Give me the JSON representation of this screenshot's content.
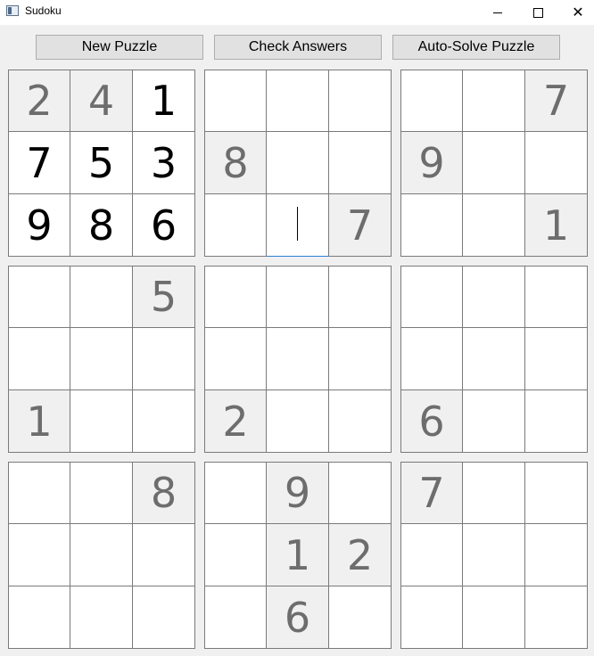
{
  "window": {
    "title": "Sudoku",
    "close_glyph": "✕"
  },
  "toolbar": {
    "new_puzzle": "New Puzzle",
    "check_answers": "Check Answers",
    "auto_solve": "Auto-Solve Puzzle"
  },
  "grid": [
    [
      [
        {
          "v": "2",
          "given": true
        },
        {
          "v": "4",
          "given": true
        },
        {
          "v": "1",
          "given": false
        }
      ],
      [
        {
          "v": "7",
          "given": false
        },
        {
          "v": "5",
          "given": false
        },
        {
          "v": "3",
          "given": false
        }
      ],
      [
        {
          "v": "9",
          "given": false
        },
        {
          "v": "8",
          "given": false
        },
        {
          "v": "6",
          "given": false
        }
      ]
    ],
    [
      [
        {
          "v": "",
          "given": false
        },
        {
          "v": "",
          "given": false
        },
        {
          "v": "",
          "given": false
        }
      ],
      [
        {
          "v": "8",
          "given": true
        },
        {
          "v": "",
          "given": false
        },
        {
          "v": "",
          "given": false
        }
      ],
      [
        {
          "v": "",
          "given": false
        },
        {
          "v": "",
          "given": false,
          "focused": true
        },
        {
          "v": "7",
          "given": true
        }
      ]
    ],
    [
      [
        {
          "v": "",
          "given": false
        },
        {
          "v": "",
          "given": false
        },
        {
          "v": "7",
          "given": true
        }
      ],
      [
        {
          "v": "9",
          "given": true
        },
        {
          "v": "",
          "given": false
        },
        {
          "v": "",
          "given": false
        }
      ],
      [
        {
          "v": "",
          "given": false
        },
        {
          "v": "",
          "given": false
        },
        {
          "v": "1",
          "given": true
        }
      ]
    ],
    [
      [
        {
          "v": "",
          "given": false
        },
        {
          "v": "",
          "given": false
        },
        {
          "v": "5",
          "given": true
        }
      ],
      [
        {
          "v": "",
          "given": false
        },
        {
          "v": "",
          "given": false
        },
        {
          "v": "",
          "given": false
        }
      ],
      [
        {
          "v": "1",
          "given": true
        },
        {
          "v": "",
          "given": false
        },
        {
          "v": "",
          "given": false
        }
      ]
    ],
    [
      [
        {
          "v": "",
          "given": false
        },
        {
          "v": "",
          "given": false
        },
        {
          "v": "",
          "given": false
        }
      ],
      [
        {
          "v": "",
          "given": false
        },
        {
          "v": "",
          "given": false
        },
        {
          "v": "",
          "given": false
        }
      ],
      [
        {
          "v": "2",
          "given": true
        },
        {
          "v": "",
          "given": false
        },
        {
          "v": "",
          "given": false
        }
      ]
    ],
    [
      [
        {
          "v": "",
          "given": false
        },
        {
          "v": "",
          "given": false
        },
        {
          "v": "",
          "given": false
        }
      ],
      [
        {
          "v": "",
          "given": false
        },
        {
          "v": "",
          "given": false
        },
        {
          "v": "",
          "given": false
        }
      ],
      [
        {
          "v": "6",
          "given": true
        },
        {
          "v": "",
          "given": false
        },
        {
          "v": "",
          "given": false
        }
      ]
    ],
    [
      [
        {
          "v": "",
          "given": false
        },
        {
          "v": "",
          "given": false
        },
        {
          "v": "8",
          "given": true
        }
      ],
      [
        {
          "v": "",
          "given": false
        },
        {
          "v": "",
          "given": false
        },
        {
          "v": "",
          "given": false
        }
      ],
      [
        {
          "v": "",
          "given": false
        },
        {
          "v": "",
          "given": false
        },
        {
          "v": "",
          "given": false
        }
      ]
    ],
    [
      [
        {
          "v": "",
          "given": false
        },
        {
          "v": "9",
          "given": true
        },
        {
          "v": "",
          "given": false
        }
      ],
      [
        {
          "v": "",
          "given": false
        },
        {
          "v": "1",
          "given": true
        },
        {
          "v": "2",
          "given": true
        }
      ],
      [
        {
          "v": "",
          "given": false
        },
        {
          "v": "6",
          "given": true
        },
        {
          "v": "",
          "given": false
        }
      ]
    ],
    [
      [
        {
          "v": "7",
          "given": true
        },
        {
          "v": "",
          "given": false
        },
        {
          "v": "",
          "given": false
        }
      ],
      [
        {
          "v": "",
          "given": false
        },
        {
          "v": "",
          "given": false
        },
        {
          "v": "",
          "given": false
        }
      ],
      [
        {
          "v": "",
          "given": false
        },
        {
          "v": "",
          "given": false
        },
        {
          "v": "",
          "given": false
        }
      ]
    ]
  ],
  "colors": {
    "given_bg": "#f0f0f0",
    "given_text": "#6d6d6d",
    "cell_bg": "#ffffff",
    "focus_accent": "#2a7fd4"
  }
}
